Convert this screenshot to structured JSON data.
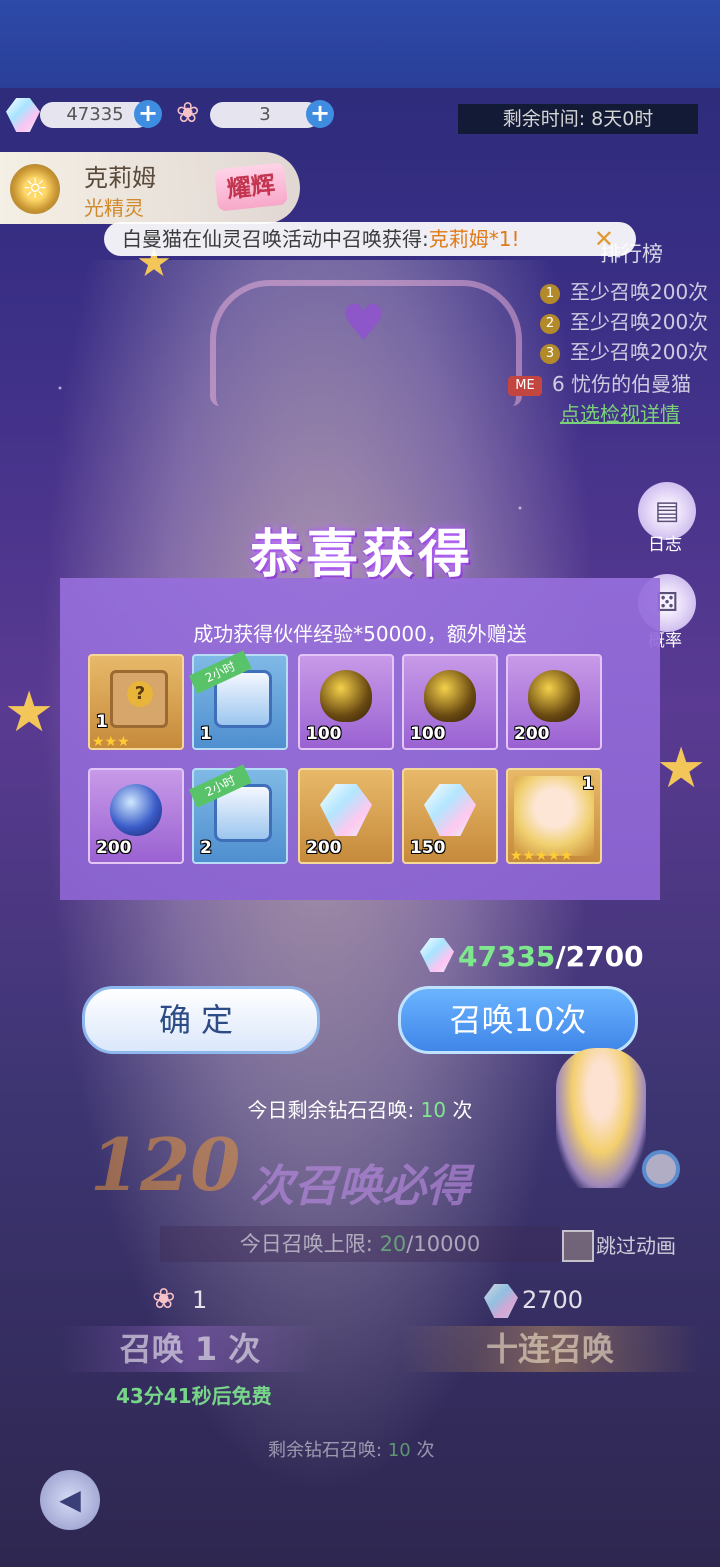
{
  "resources": {
    "gems": "47335",
    "tulips": "3"
  },
  "timer": "剩余时间: 8天0时",
  "hero": {
    "name": "克莉姆",
    "subtitle": "光精灵",
    "badge": "耀辉"
  },
  "marquee": {
    "text": "白曼猫在仙灵召唤活动中召唤获得:",
    "highlight": "克莉姆*1!"
  },
  "ranking": {
    "title": "排行榜",
    "rows": [
      {
        "n": "1",
        "text": "至少召唤200次"
      },
      {
        "n": "2",
        "text": "至少召唤200次"
      },
      {
        "n": "3",
        "text": "至少召唤200次"
      },
      {
        "n": "ME",
        "text": "6  忧伤的伯曼猫"
      }
    ],
    "link": "点选检视详情"
  },
  "side": {
    "log_label": "日志",
    "prob_label": "概率"
  },
  "reward": {
    "title": "恭喜获得",
    "desc": "成功获得伙伴经验*50000，额外赠送",
    "tag": "2小时",
    "items": [
      {
        "qty": "1",
        "icon": "mystery-box-icon",
        "rarity": "gold"
      },
      {
        "qty": "1",
        "icon": "treasure-chest-icon",
        "rarity": "blue"
      },
      {
        "qty": "100",
        "icon": "golden-egg-icon",
        "rarity": "purple"
      },
      {
        "qty": "100",
        "icon": "golden-egg-icon",
        "rarity": "purple"
      },
      {
        "qty": "200",
        "icon": "golden-egg-icon",
        "rarity": "purple"
      },
      {
        "qty": "200",
        "icon": "crystal-orb-icon",
        "rarity": "purple"
      },
      {
        "qty": "2",
        "icon": "treasure-chest-icon",
        "rarity": "blue"
      },
      {
        "qty": "200",
        "icon": "diamond-gem-icon",
        "rarity": "gold"
      },
      {
        "qty": "150",
        "icon": "diamond-gem-icon",
        "rarity": "gold"
      },
      {
        "qty": "1",
        "icon": "character-portrait-icon",
        "rarity": "gold"
      }
    ],
    "stars3": "★★★",
    "stars5": "★★★★★"
  },
  "cost": {
    "have": "47335",
    "need": "/2700"
  },
  "buttons": {
    "confirm": "确定",
    "summon10": "召唤10次"
  },
  "today": {
    "label": "今日剩余钻石召唤:",
    "count": "10",
    "unit": "次"
  },
  "guarantee": {
    "number": "120",
    "text": "次召唤必得"
  },
  "limit": {
    "label": "今日召唤上限:",
    "current": "20",
    "max": "/10000"
  },
  "skip_label": "跳过动画",
  "summon": {
    "single_cost": "1",
    "ten_cost": "2700",
    "single_label": "召唤 1 次",
    "ten_label": "十连召唤",
    "free_time": "43分41秒",
    "free_suffix": "后免费",
    "remain_label": "剩余钻石召唤:",
    "remain_count": "10",
    "remain_unit": "次"
  },
  "colors": {
    "accent_green": "#7fe88e",
    "highlight_orange": "#e07a16",
    "button_blue": "#3f86e8"
  }
}
